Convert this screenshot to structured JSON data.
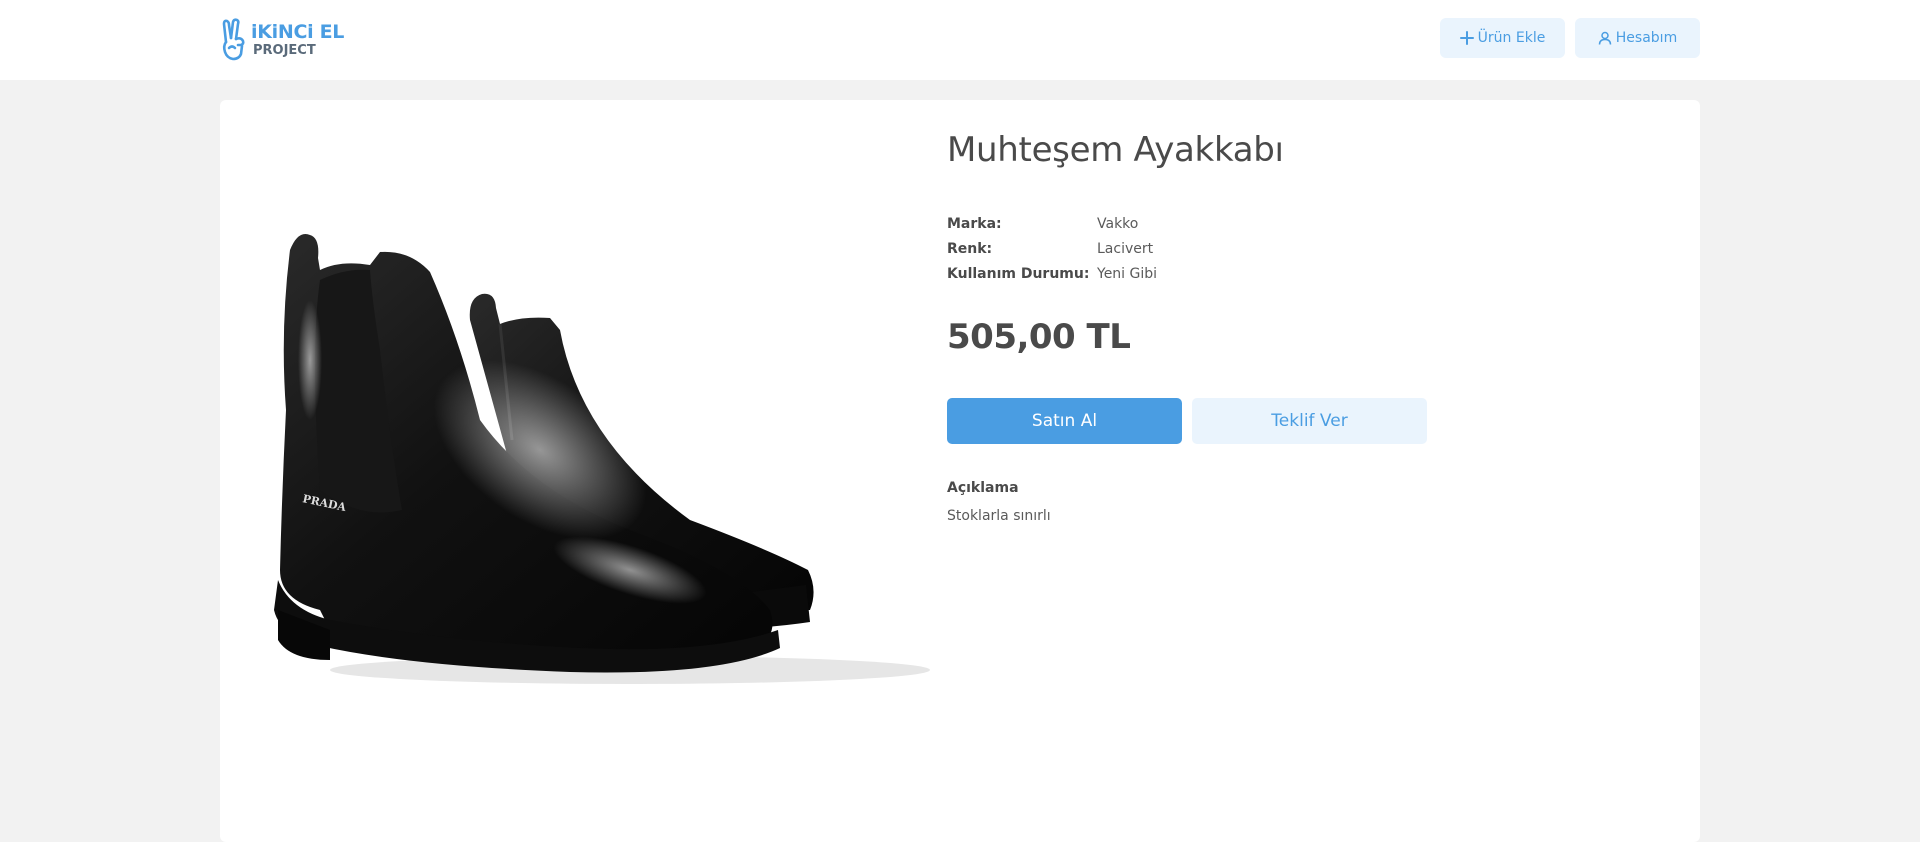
{
  "header": {
    "logo_title": "iKiNCi EL",
    "logo_subtitle": "PROJECT",
    "add_product_label": "Ürün Ekle",
    "account_label": "Hesabım"
  },
  "product": {
    "title": "Muhteşem Ayakkabı",
    "image_brand_text": "PRADA",
    "specs": [
      {
        "label": "Marka:",
        "value": "Vakko"
      },
      {
        "label": "Renk:",
        "value": "Lacivert"
      },
      {
        "label": "Kullanım Durumu:",
        "value": "Yeni Gibi"
      }
    ],
    "price": "505,00 TL",
    "buy_label": "Satın Al",
    "offer_label": "Teklif Ver",
    "description_title": "Açıklama",
    "description_text": "Stoklarla sınırlı"
  },
  "colors": {
    "accent": "#4a9de2",
    "accent_light": "#eaf4fd",
    "background": "#f2f2f2",
    "text": "#4a4a4a"
  },
  "icons": {
    "logo": "peace-hand-icon",
    "add": "plus-icon",
    "account": "user-icon"
  }
}
